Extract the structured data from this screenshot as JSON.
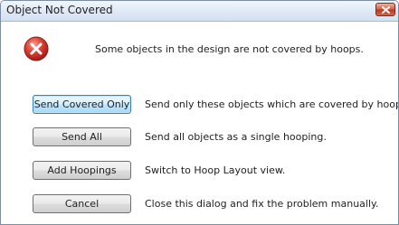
{
  "window": {
    "title": "Object Not Covered"
  },
  "message": {
    "icon": "error-icon",
    "text": "Some objects in the design are not covered by hoops."
  },
  "options": [
    {
      "label": "Send Covered Only",
      "description": "Send only these objects which are covered by hoops."
    },
    {
      "label": "Send All",
      "description": "Send all objects as a single hooping."
    },
    {
      "label": "Add Hoopings",
      "description": "Switch to Hoop Layout view."
    },
    {
      "label": "Cancel",
      "description": "Close this dialog and fix the problem manually."
    }
  ],
  "colors": {
    "error_red": "#c62a1e",
    "close_button": "#c2351e",
    "default_button_border": "#3c7fb1"
  }
}
